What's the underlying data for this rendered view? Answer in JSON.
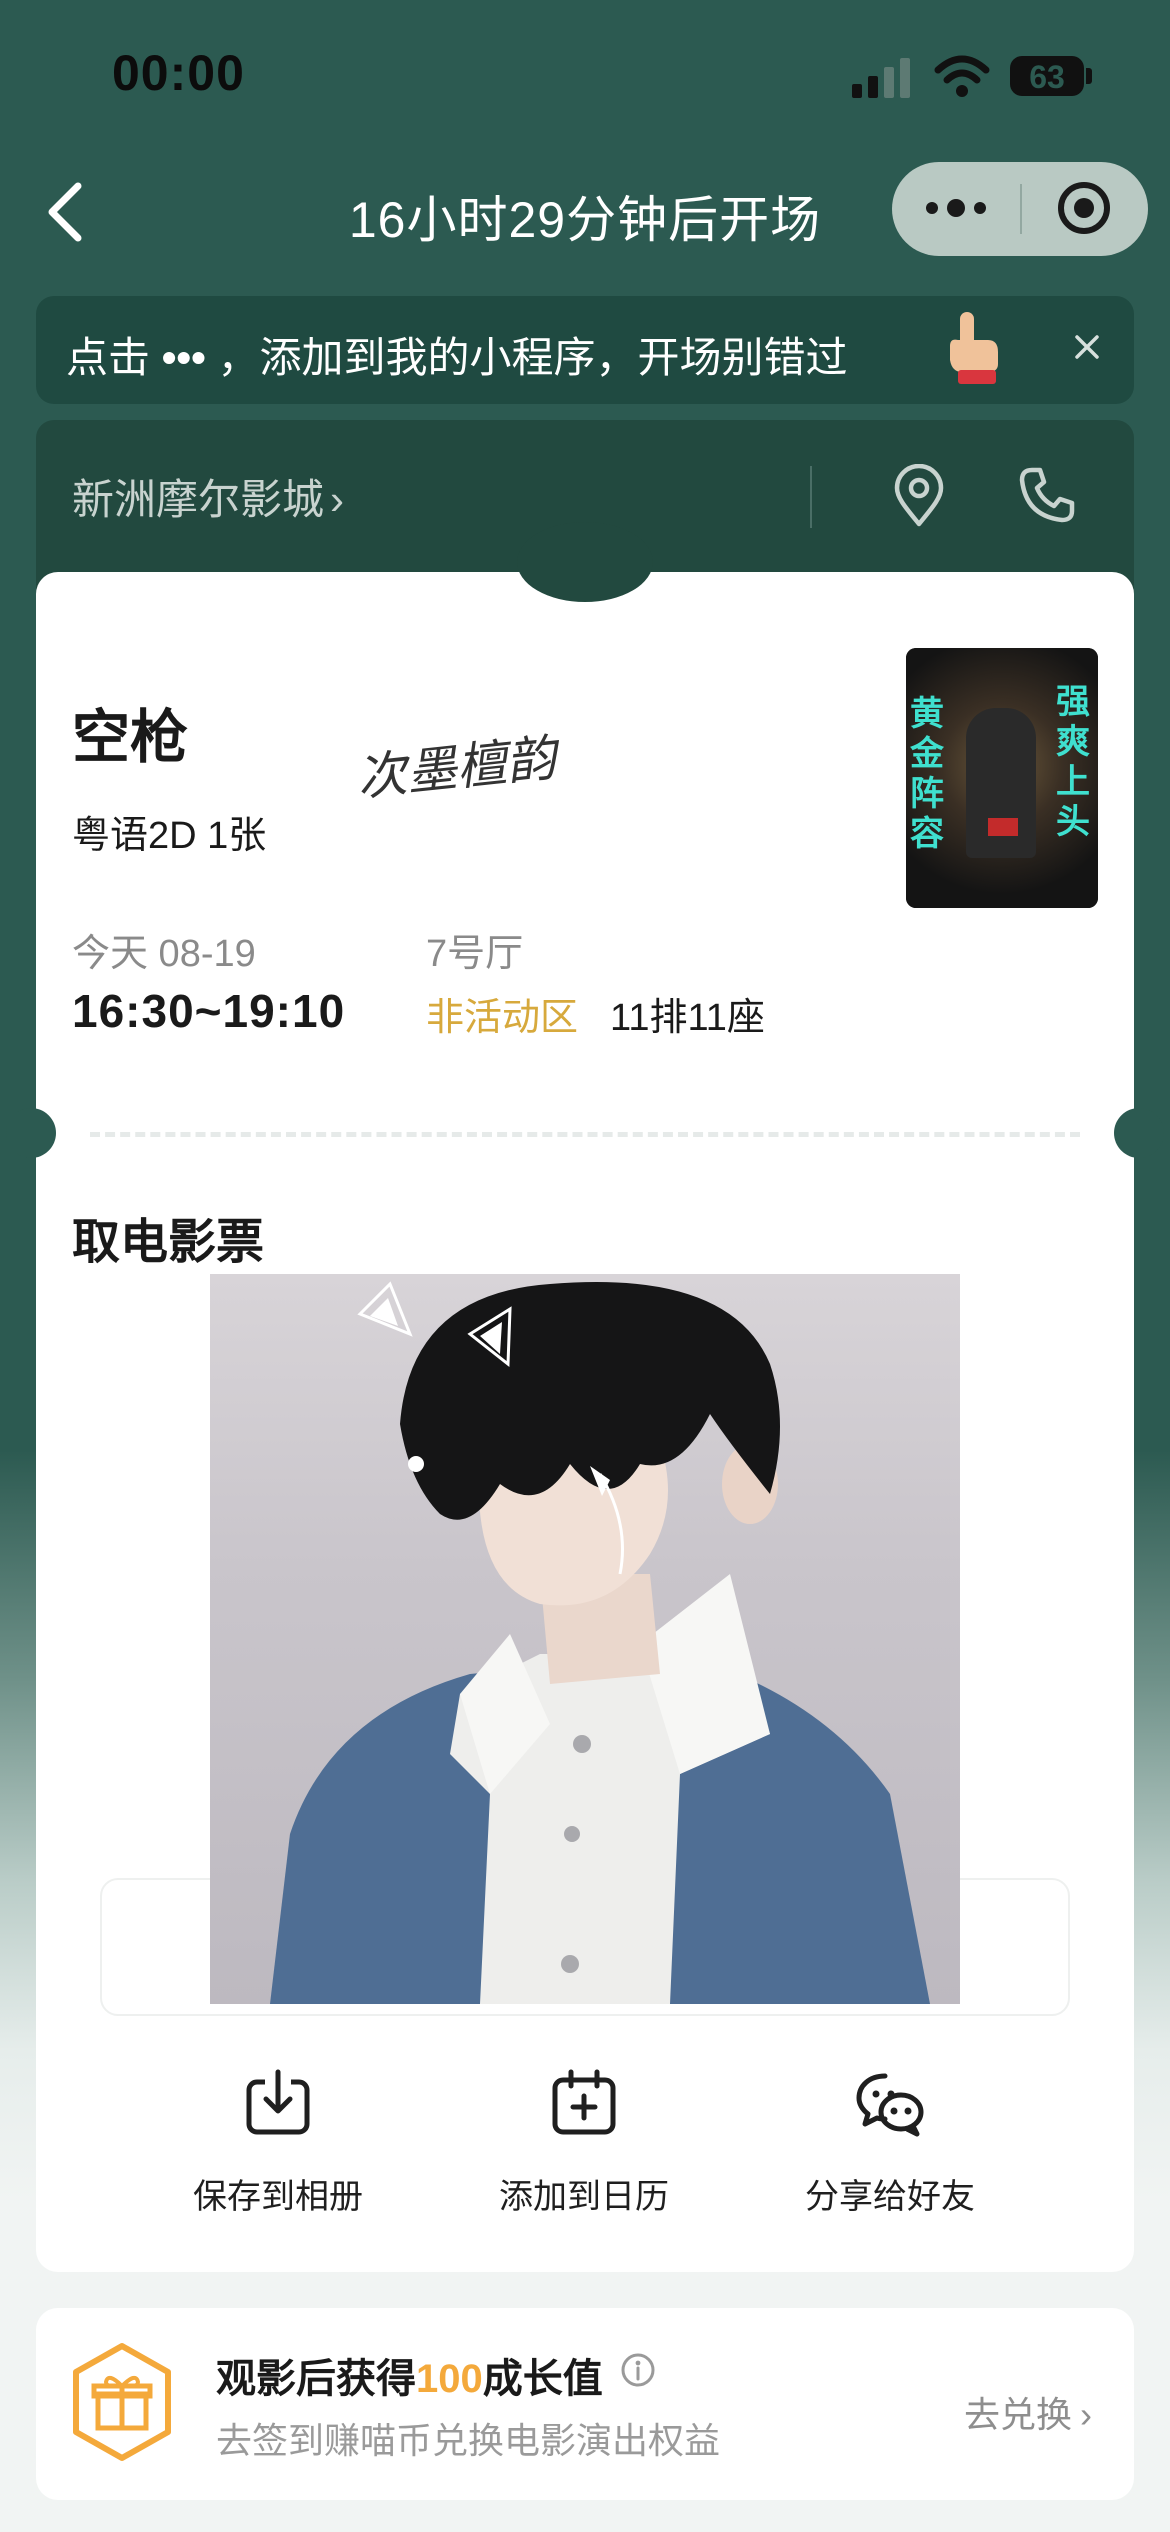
{
  "status": {
    "time": "00:00",
    "battery": "63"
  },
  "nav": {
    "title": "16小时29分钟后开场"
  },
  "tip": {
    "prefix": "点击",
    "dots": "•••",
    "text": "，添加到我的小程序，开场别错过"
  },
  "cinema": {
    "name": "新洲摩尔影城"
  },
  "movie": {
    "title": "空枪",
    "signature": "次墨檀韵",
    "meta": "粤语2D 1张",
    "poster": {
      "left_text": "黄金阵容",
      "right_text": "强爽上头"
    },
    "date": "今天 08-19",
    "time": "16:30~19:10",
    "hall": "7号厅",
    "zone": "非活动区",
    "seat": "11排11座"
  },
  "ticket_section": {
    "title": "取电影票"
  },
  "actions": [
    {
      "label": "保存到相册",
      "icon": "download-icon"
    },
    {
      "label": "添加到日历",
      "icon": "calendar-add-icon"
    },
    {
      "label": "分享给好友",
      "icon": "wechat-share-icon"
    }
  ],
  "bonus": {
    "title_pre": "观影后获得",
    "title_num": "100",
    "title_post": "成长值",
    "subtitle": "去签到赚喵币兑换电影演出权益",
    "link": "去兑换"
  },
  "colors": {
    "background": "#2c5a51",
    "accent": "#d7a93c",
    "bonus_accent": "#f4a93b"
  }
}
